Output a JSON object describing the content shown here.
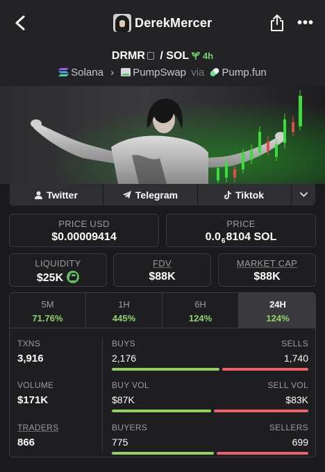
{
  "header": {
    "title": "DerekMercer",
    "back_icon": "chevron-left-icon",
    "share_icon": "share-icon",
    "more_icon": "ellipsis-icon",
    "more_glyph": "•••"
  },
  "pair": {
    "base": "DRMR",
    "separator": "/",
    "quote": "SOL",
    "age": "4h",
    "chain": "Solana",
    "dex": "PumpSwap",
    "via": "via",
    "launchpad": "Pump.fun",
    "chevron": "›"
  },
  "social": {
    "twitter": "Twitter",
    "telegram": "Telegram",
    "tiktok": "Tiktok",
    "expand_icon": "chevron-down-icon"
  },
  "price": {
    "usd_label": "PRICE USD",
    "usd_value": "$0.00009414",
    "native_label": "PRICE",
    "native_prefix": "0.0",
    "native_zeros": "6",
    "native_digits": "8104 SOL"
  },
  "metrics": {
    "liquidity_label": "LIQUIDITY",
    "liquidity_value": "$25K",
    "fdv_label": "FDV",
    "fdv_value": "$88K",
    "mcap_label": "MARKET CAP",
    "mcap_value": "$88K"
  },
  "tabs": [
    {
      "label": "5M",
      "value": "71.76%"
    },
    {
      "label": "1H",
      "value": "445%"
    },
    {
      "label": "6H",
      "value": "124%"
    },
    {
      "label": "24H",
      "value": "124%"
    }
  ],
  "active_tab": "24H",
  "stats": {
    "txns_label": "TXNS",
    "txns_value": "3,916",
    "volume_label": "VOLUME",
    "volume_value": "$171K",
    "traders_label": "TRADERS",
    "traders_value": "866",
    "buys_label": "BUYS",
    "buys_value": "2,176",
    "sells_label": "SELLS",
    "sells_value": "1,740",
    "buy_vol_label": "BUY VOL",
    "buy_vol_value": "$87K",
    "sell_vol_label": "SELL VOL",
    "sell_vol_value": "$83K",
    "buyers_label": "BUYERS",
    "buyers_value": "775",
    "sellers_label": "SELLERS",
    "sellers_value": "699"
  },
  "ratios": {
    "buys_share": 0.556,
    "buy_vol_share": 0.512,
    "buyers_share": 0.526
  },
  "colors": {
    "positive": "#8fd46a",
    "buy_bar": "#93d05f",
    "sell_bar": "#f06068",
    "chart_green": "#3bdc3b"
  }
}
